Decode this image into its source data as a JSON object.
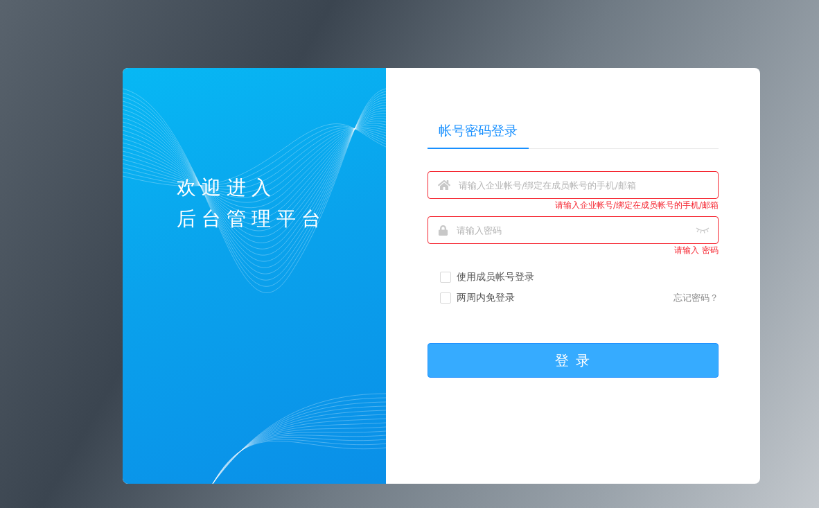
{
  "welcome": {
    "lines": [
      "欢迎进入",
      "后台管理平台"
    ]
  },
  "tabs": [
    {
      "label": "帐号密码登录",
      "selected": true
    }
  ],
  "fields": [
    {
      "kind": "account",
      "placeholder": "请输入企业帐号/绑定在成员帐号的手机/邮箱",
      "error": "请输入企业帐号/绑定在成员帐号的手机/邮箱"
    },
    {
      "kind": "password",
      "placeholder": "请输入密码",
      "error": "请输入 密码"
    }
  ],
  "options": [
    {
      "label": "使用成员帐号登录",
      "checked": false
    },
    {
      "label": "两周内免登录",
      "checked": false
    }
  ],
  "forgot_link": "忘记密码？",
  "submit": {
    "label": "登 录"
  }
}
